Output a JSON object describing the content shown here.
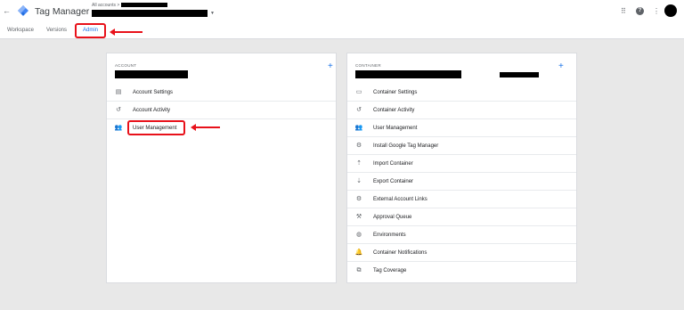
{
  "header": {
    "back_icon": "arrow-left-icon",
    "app_title": "Tag Manager",
    "breadcrumb": "All accounts >",
    "icons": [
      "apps-grid-icon",
      "help-icon",
      "more-vert-icon"
    ]
  },
  "tabs": {
    "workspace": "Workspace",
    "versions": "Versions",
    "admin": "Admin"
  },
  "account": {
    "section_label": "ACCOUNT",
    "plus": "+",
    "items": [
      {
        "label": "Account Settings",
        "icon": "building-icon",
        "glyph": "▤"
      },
      {
        "label": "Account Activity",
        "icon": "history-icon",
        "glyph": "↺"
      },
      {
        "label": "User Management",
        "icon": "people-icon",
        "glyph": "👥"
      }
    ]
  },
  "container": {
    "section_label": "CONTAINER",
    "plus": "+",
    "items": [
      {
        "label": "Container Settings",
        "icon": "window-icon",
        "glyph": "▭"
      },
      {
        "label": "Container Activity",
        "icon": "history-icon",
        "glyph": "↺"
      },
      {
        "label": "User Management",
        "icon": "people-icon",
        "glyph": "👥"
      },
      {
        "label": "Install Google Tag Manager",
        "icon": "gear-icon",
        "glyph": "⚙"
      },
      {
        "label": "Import Container",
        "icon": "upload-icon",
        "glyph": "⇡"
      },
      {
        "label": "Export Container",
        "icon": "download-icon",
        "glyph": "⇣"
      },
      {
        "label": "External Account Links",
        "icon": "gear-icon",
        "glyph": "⚙"
      },
      {
        "label": "Approval Queue",
        "icon": "gavel-icon",
        "glyph": "⚒"
      },
      {
        "label": "Environments",
        "icon": "globe-icon",
        "glyph": "◍"
      },
      {
        "label": "Container Notifications",
        "icon": "bell-icon",
        "glyph": "🔔"
      },
      {
        "label": "Tag Coverage",
        "icon": "sitemap-icon",
        "glyph": "⧉"
      }
    ]
  },
  "colors": {
    "accent": "#1a73e8",
    "highlight": "#e8111a",
    "background": "#e8e8e8"
  }
}
